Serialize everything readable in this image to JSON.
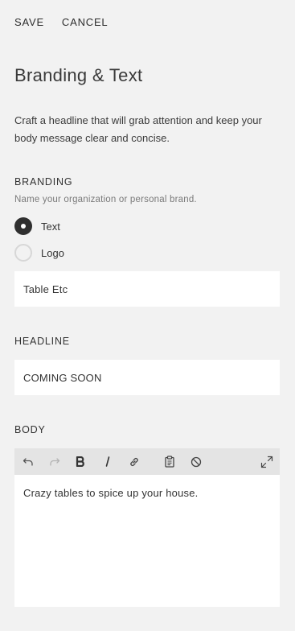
{
  "header": {
    "save_label": "SAVE",
    "cancel_label": "CANCEL"
  },
  "page_title": "Branding & Text",
  "intro_text": "Craft a headline that will grab attention and keep your body message clear and concise.",
  "branding": {
    "label": "BRANDING",
    "help": "Name your organization or personal brand.",
    "options": [
      {
        "label": "Text",
        "selected": true
      },
      {
        "label": "Logo",
        "selected": false
      }
    ],
    "value": "Table Etc"
  },
  "headline": {
    "label": "HEADLINE",
    "value": "COMING SOON"
  },
  "body": {
    "label": "BODY",
    "toolbar": [
      "undo-icon",
      "redo-icon",
      "bold-icon",
      "italic-icon",
      "link-icon",
      "paste-icon",
      "clear-format-icon",
      "expand-icon"
    ],
    "value": "Crazy tables to spice up your house."
  },
  "colors": {
    "background": "#f2f2f2",
    "field": "#ffffff",
    "toolbar": "#e4e4e4",
    "radio_selected": "#2f2f2f"
  }
}
